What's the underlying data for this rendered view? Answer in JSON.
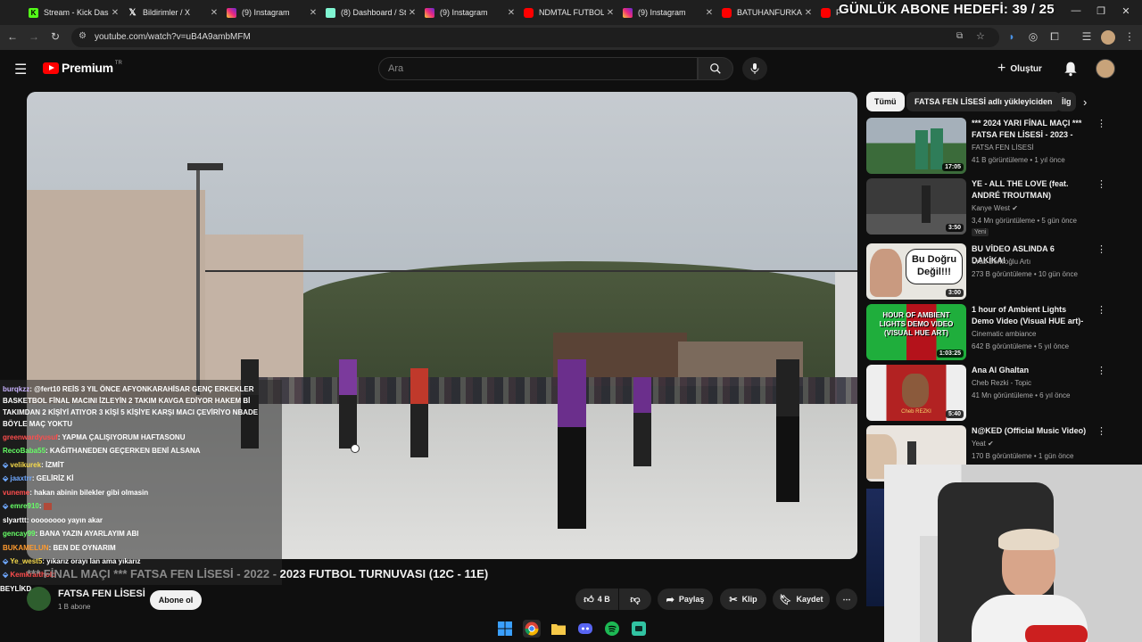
{
  "browser": {
    "tabs": [
      {
        "label": "Stream - Kick Dashboard",
        "icon": "kick-icon",
        "color": "#53fc18"
      },
      {
        "label": "Bildirimler / X",
        "icon": "x-icon",
        "color": "#ffffff"
      },
      {
        "label": "(9) Instagram",
        "icon": "instagram-icon",
        "color": "#e1306c"
      },
      {
        "label": "(8) Dashboard / Streamlabs",
        "icon": "streamlabs-icon",
        "color": "#80f5d2"
      },
      {
        "label": "(9) Instagram",
        "icon": "instagram-icon",
        "color": "#e1306c"
      },
      {
        "label": "NDMTAL FUTBOL",
        "icon": "youtube-icon",
        "color": "#ff0000"
      },
      {
        "label": "(9) Instagram",
        "icon": "instagram-icon",
        "color": "#e1306c"
      },
      {
        "label": "BATUHANFURKAN",
        "icon": "youtube-icon",
        "color": "#ff0000"
      },
      {
        "label": "F",
        "icon": "youtube-icon",
        "color": "#ff0000"
      }
    ],
    "url": "youtube.com/watch?v=uB4A9ambMFM",
    "overlay_goal": "GÜNLÜK ABONE HEDEFİ: 39 / 25"
  },
  "youtube": {
    "logo_word": "Premium",
    "logo_region": "TR",
    "search_placeholder": "Ara",
    "create_label": "Oluştur"
  },
  "chat": [
    {
      "user": "burqkzz",
      "color": "#c9b3ff",
      "text": ": @fert10 REİS 3 YIL ÖNCE AFYONKARAHİSAR GENÇ ERKEKLER"
    },
    {
      "user": "",
      "color": "#ffffff",
      "text": "BASKETBOL FİNAL MACINI İZLEYİN 2 TAKIM KAVGA EDİYOR HAKEM Bİ"
    },
    {
      "user": "",
      "color": "#ffffff",
      "text": "TAKIMDAN 2 KİŞİYİ ATIYOR 3 KİŞİ 5 KİŞİYE KARŞI MACI ÇEVİRİYO NBADE"
    },
    {
      "user": "",
      "color": "#ffffff",
      "text": "BÖYLE MAÇ YOKTU"
    },
    {
      "user": "greenwardyusuf",
      "color": "#ff4d4d",
      "text": ": YAPMA ÇALIŞIYORUM HAFTASONU"
    },
    {
      "user": "RecoBaba55",
      "color": "#66ff66",
      "text": ": KAĞITHANEDEN GEÇERKEN BENİ ALSANA"
    },
    {
      "user": "velikurek",
      "color": "#f5d94b",
      "text": ": İZMİT"
    },
    {
      "user": "jaaxtrr",
      "color": "#6fa8ff",
      "text": ": GELİRİZ Kİ"
    },
    {
      "user": "vuneme",
      "color": "#ff4d4d",
      "text": ": hakan abinin bilekler gibi olmasin"
    },
    {
      "user": "emre910",
      "color": "#66ff66",
      "text": ": "
    },
    {
      "user": "slyarttt",
      "color": "#ffffff",
      "text": ": oooooooo yayın akar"
    },
    {
      "user": "gencay99",
      "color": "#66ff66",
      "text": ": BANA YAZIN AYARLAYIM ABI"
    },
    {
      "user": "BUKAMELUN",
      "color": "#ff9a2e",
      "text": ": BEN DE OYNARIM"
    },
    {
      "user": "Ye_west5",
      "color": "#f5d94b",
      "text": ": yıkarız orayı lan ama yıkarız"
    },
    {
      "user": "Kemkrafthold",
      "color": "#ff4d4d",
      "text": ""
    },
    {
      "user": "",
      "color": "#ffffff",
      "text": "BEYLİKD"
    }
  ],
  "video": {
    "title_prefix": "*** FİNAL MAÇI *** FATSA FEN LİSESİ - 2022 - ",
    "title_main": "2023 FUTBOL TURNUVASI (12C - 11E)",
    "channel": "FATSA FEN LİSESİ",
    "subscribers": "1 B abone",
    "subscribe_label": "Abone ol",
    "likes": "4 B",
    "share_label": "Paylaş",
    "clip_label": "Klip",
    "save_label": "Kaydet"
  },
  "sidebar": {
    "chips": [
      "Tümü",
      "FATSA FEN LİSESİ adlı yükleyiciden",
      "İlg"
    ],
    "recommendations": [
      {
        "title": "*** 2024 YARI FİNAL MAÇI *** FATSA FEN LİSESİ - 2023 - 20...",
        "channel": "FATSA FEN LİSESİ",
        "meta": "41 B görüntüleme • 1 yıl önce",
        "duration": "17:05",
        "badge": "",
        "thumb_color": "#3b6b3a"
      },
      {
        "title": "YE - ALL THE LOVE (feat. ANDRÉ TROUTMAN)",
        "channel": "Kanye West",
        "meta": "3,4 Mn görüntüleme • 5 gün önce",
        "duration": "3:50",
        "badge": "Yeni",
        "thumb_color": "#3a3a3a"
      },
      {
        "title": "BU VİDEO ASLINDA 6 DAKİKA!",
        "channel": "Uras Benlioğlu Artı",
        "meta": "273 B görüntüleme • 10 gün önce",
        "duration": "3:00",
        "badge": "",
        "thumb_color": "#e8e6e0",
        "thumb_text": "Bu Doğru Değil!!!"
      },
      {
        "title": "1 hour of Ambient Lights Demo Video (Visual HUE art)- Play ...",
        "channel": "Cinematic ambiance",
        "meta": "642 B görüntüleme • 5 yıl önce",
        "duration": "1:03:25",
        "badge": "",
        "thumb_color": "#1fae3c",
        "thumb_text": "HOUR OF AMBIENT LIGHTS DEMO VIDEO (VISUAL HUE ART)"
      },
      {
        "title": "Ana Al Ghaltan",
        "channel": "Cheb Rezki - Topic",
        "meta": "41 Mn görüntüleme • 6 yıl önce",
        "duration": "5:40",
        "badge": "",
        "thumb_color": "#b22222",
        "thumb_text": "Cheb REZKI"
      },
      {
        "title": "N@KED (Official Music Video)",
        "channel": "Yeat",
        "meta": "170 B görüntüleme • 1 gün önce",
        "duration": "",
        "badge": "",
        "thumb_color": "#e9e4de"
      }
    ]
  },
  "taskbar": [
    "windows-start-icon",
    "chrome-icon",
    "file-explorer-icon",
    "discord-icon",
    "spotify-icon",
    "streamlabs-icon"
  ]
}
